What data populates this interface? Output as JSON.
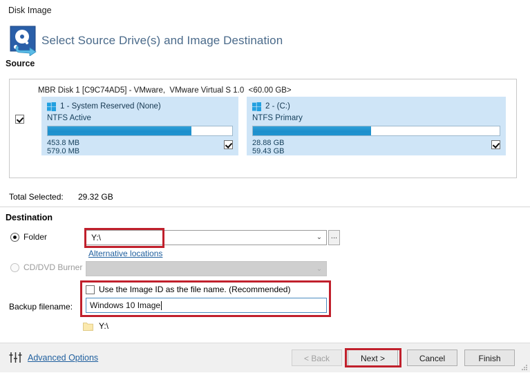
{
  "window": {
    "title": "Disk Image"
  },
  "banner": {
    "title": "Select Source Drive(s) and Image Destination",
    "section_label": "Source",
    "icon": "hard-disk-icon"
  },
  "source": {
    "disk_header": "MBR Disk 1 [C9C74AD5] - VMware,  VMware Virtual S 1.0  <60.00 GB>",
    "disk_checked": true,
    "partitions": [
      {
        "icon": "windows-logo-icon",
        "name": "1 - System Reserved (None)",
        "filesystem": "NTFS Active",
        "used": "453.8 MB",
        "total": "579.0 MB",
        "fill_percent": 78,
        "checked": true
      },
      {
        "icon": "windows-logo-icon",
        "name": "2 -  (C:)",
        "filesystem": "NTFS Primary",
        "used": "28.88 GB",
        "total": "59.43 GB",
        "fill_percent": 48,
        "checked": true
      }
    ]
  },
  "total": {
    "label": "Total Selected:",
    "value": "29.32 GB"
  },
  "destination": {
    "title": "Destination",
    "folder_radio_label": "Folder",
    "folder_radio_selected": true,
    "folder_value": "Y:\\",
    "folder_chevron": "⌄",
    "browse_label": "...",
    "alternative_locations_link": "Alternative locations",
    "cd_radio_label": "CD/DVD Burner",
    "cd_radio_selected": false,
    "cd_combo_value": "",
    "cd_chevron": "⌄",
    "backup_filename_label": "Backup filename:",
    "use_image_id_label": "Use the Image ID as the file name.  (Recommended)",
    "use_image_id_checked": false,
    "filename_value": "Windows 10 Image",
    "dest_path_value": "Y:\\",
    "folder_icon": "folder-icon"
  },
  "footer": {
    "advanced_options_label": "Advanced Options",
    "advanced_icon": "sliders-icon",
    "buttons": {
      "back": "< Back",
      "next": "Next >",
      "cancel": "Cancel",
      "finish": "Finish"
    }
  },
  "colors": {
    "highlight_red": "#c0202c",
    "partition_panel": "#cfe5f7",
    "bar_blue": "#1d8fcc",
    "link_blue": "#1f5f9e",
    "banner_title": "#4a6a8a"
  }
}
